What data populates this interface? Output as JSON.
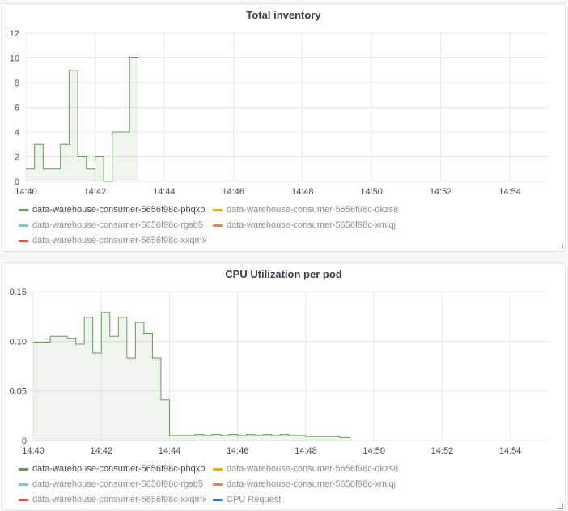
{
  "chart_data": [
    {
      "type": "area",
      "title": "Total inventory",
      "x_tick_labels": [
        "14:40",
        "14:42",
        "14:44",
        "14:46",
        "14:48",
        "14:50",
        "14:52",
        "14:54"
      ],
      "y_tick_labels": [
        "0",
        "2",
        "4",
        "6",
        "8",
        "10",
        "12"
      ],
      "ylim": [
        0,
        12
      ],
      "x_unit": "minutes after 14:40",
      "xlim": [
        0,
        15.1
      ],
      "grid": true,
      "legend_placement": "bottom",
      "series": [
        {
          "name": "data-warehouse-consumer-5656f98c-phqxb",
          "color": "#629e51",
          "step": true,
          "points": [
            [
              0,
              1
            ],
            [
              0.25,
              3
            ],
            [
              0.5,
              1
            ],
            [
              1.0,
              3
            ],
            [
              1.25,
              9
            ],
            [
              1.5,
              2
            ],
            [
              1.75,
              1
            ],
            [
              2.0,
              2
            ],
            [
              2.25,
              0
            ],
            [
              2.5,
              4
            ],
            [
              3.0,
              10
            ],
            [
              3.25,
              10
            ]
          ]
        }
      ],
      "legend": [
        {
          "label": "data-warehouse-consumer-5656f98c-phqxb",
          "color": "#629e51",
          "active": true
        },
        {
          "label": "data-warehouse-consumer-5656f98c-qkzs8",
          "color": "#e5ac0e",
          "active": false
        },
        {
          "label": "data-warehouse-consumer-5656f98c-rgsb5",
          "color": "#6ed0e0",
          "active": false
        },
        {
          "label": "data-warehouse-consumer-5656f98c-xmlqj",
          "color": "#ef843c",
          "active": false
        },
        {
          "label": "data-warehouse-consumer-5656f98c-xxqmx",
          "color": "#e24d42",
          "active": false
        }
      ]
    },
    {
      "type": "area",
      "title": "CPU Utilization per pod",
      "x_tick_labels": [
        "14:40",
        "14:42",
        "14:44",
        "14:46",
        "14:48",
        "14:50",
        "14:52",
        "14:54"
      ],
      "y_tick_labels": [
        "0",
        "0.05",
        "0.10",
        "0.15"
      ],
      "ylim": [
        0,
        0.15
      ],
      "x_unit": "minutes after 14:40",
      "xlim": [
        0,
        15.1
      ],
      "grid": true,
      "legend_placement": "bottom",
      "series": [
        {
          "name": "data-warehouse-consumer-5656f98c-phqxb",
          "color": "#629e51",
          "step": true,
          "points": [
            [
              0,
              0.099
            ],
            [
              0.5,
              0.105
            ],
            [
              1.0,
              0.103
            ],
            [
              1.25,
              0.097
            ],
            [
              1.5,
              0.124
            ],
            [
              1.75,
              0.088
            ],
            [
              2.0,
              0.129
            ],
            [
              2.25,
              0.105
            ],
            [
              2.5,
              0.124
            ],
            [
              2.75,
              0.083
            ],
            [
              3.0,
              0.119
            ],
            [
              3.25,
              0.108
            ],
            [
              3.5,
              0.083
            ],
            [
              3.75,
              0.041
            ],
            [
              4.0,
              0.005
            ],
            [
              4.5,
              0.005
            ],
            [
              4.75,
              0.006
            ],
            [
              5.0,
              0.005
            ],
            [
              5.25,
              0.006
            ],
            [
              5.5,
              0.005
            ],
            [
              5.75,
              0.006
            ],
            [
              6.0,
              0.005
            ],
            [
              6.25,
              0.006
            ],
            [
              6.5,
              0.005
            ],
            [
              6.75,
              0.006
            ],
            [
              7.0,
              0.005
            ],
            [
              7.25,
              0.006
            ],
            [
              7.5,
              0.005
            ],
            [
              8.0,
              0.004
            ],
            [
              8.5,
              0.004
            ],
            [
              9.0,
              0.003
            ],
            [
              9.3,
              0.003
            ]
          ]
        }
      ],
      "legend": [
        {
          "label": "data-warehouse-consumer-5656f98c-phqxb",
          "color": "#629e51",
          "active": true
        },
        {
          "label": "data-warehouse-consumer-5656f98c-qkzs8",
          "color": "#e5ac0e",
          "active": false
        },
        {
          "label": "data-warehouse-consumer-5656f98c-rgsb5",
          "color": "#6ed0e0",
          "active": false
        },
        {
          "label": "data-warehouse-consumer-5656f98c-xmlqj",
          "color": "#ef843c",
          "active": false
        },
        {
          "label": "data-warehouse-consumer-5656f98c-xxqmx",
          "color": "#e24d42",
          "active": false
        },
        {
          "label": "CPU Request",
          "color": "#1f78c1",
          "active": false
        }
      ]
    }
  ]
}
